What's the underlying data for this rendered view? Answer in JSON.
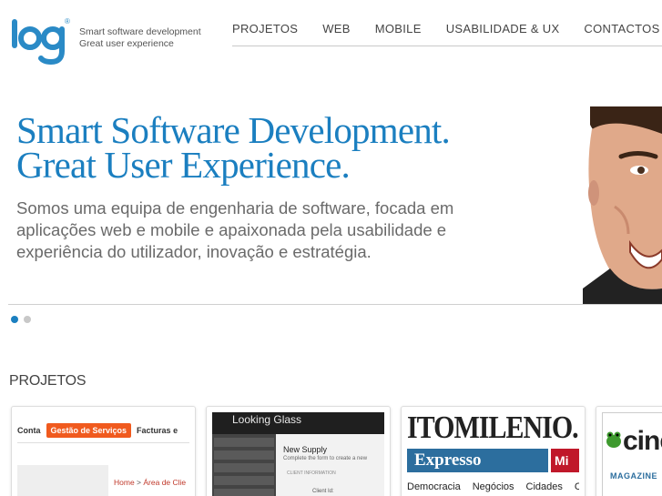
{
  "brand": {
    "logo_text": "log",
    "logo_mark": "®",
    "tagline_line1": "Smart software development",
    "tagline_line2": "Great user experience"
  },
  "nav": {
    "items": [
      {
        "label": "PROJETOS"
      },
      {
        "label": "WEB"
      },
      {
        "label": "MOBILE"
      },
      {
        "label": "USABILIDADE & UX"
      },
      {
        "label": "CONTACTOS"
      }
    ]
  },
  "hero": {
    "title_line1": "Smart Software Development.",
    "title_line2": "Great User Experience.",
    "description": "Somos uma equipa de engenharia de software, focada em aplicações web e mobile e apaixonada pela usabilidade e experiência do utilizador, inovação e estratégia.",
    "slides_count": 2,
    "active_slide": 1
  },
  "projects": {
    "title": "PROJETOS",
    "thumb1": {
      "menu": [
        "Conta",
        "Gestão de Serviços",
        "Facturas e"
      ],
      "breadcrumb_home": "Home",
      "breadcrumb_sep": " > ",
      "breadcrumb_area": "Área de Clie"
    },
    "thumb2": {
      "app_title": "Looking Glass",
      "heading": "New Supply",
      "subtitle": "Complete the form to create a new",
      "section": "CLIENT INFORMATION",
      "field": "Client Id:"
    },
    "thumb3": {
      "masthead": "ITOMILENIO.",
      "brand": "Expresso",
      "brand2": "Mi",
      "sections": [
        "Democracia",
        "Negócios",
        "Cidades",
        "Co"
      ]
    },
    "thumb4": {
      "brand": "cine",
      "label": "MAGAZINE"
    }
  },
  "colors": {
    "accent": "#1b7fc0",
    "orange": "#f05a1e",
    "expresso_blue": "#2c6e9e",
    "red": "#c0182a"
  }
}
